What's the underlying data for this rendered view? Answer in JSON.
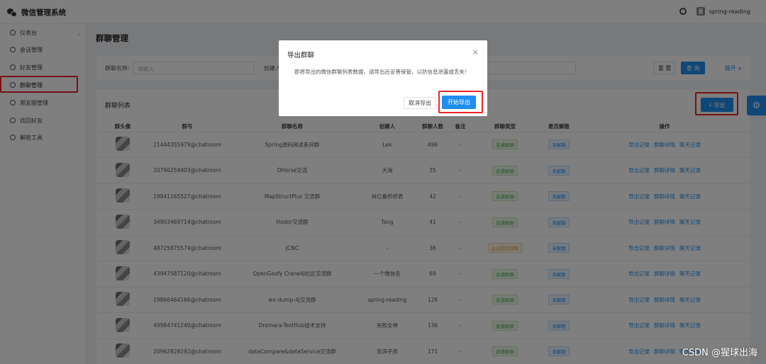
{
  "app": {
    "title": "微信管理系统",
    "user": "spring-reading"
  },
  "sidebar": {
    "items": [
      {
        "label": "仪表台",
        "icon": "dashboard-icon"
      },
      {
        "label": "会话管理",
        "icon": "chat-icon"
      },
      {
        "label": "好友管理",
        "icon": "contacts-icon"
      },
      {
        "label": "群聊管理",
        "icon": "group-chat-icon"
      },
      {
        "label": "朋友圈管理",
        "icon": "moments-icon"
      },
      {
        "label": "找回好友",
        "icon": "recover-icon"
      },
      {
        "label": "解密工具",
        "icon": "key-icon"
      }
    ]
  },
  "page": {
    "title": "群聊管理"
  },
  "search": {
    "group_name_label": "群聊名称:",
    "group_name_placeholder": "请输入",
    "creator_label": "创建人",
    "reset_label": "重 置",
    "search_label": "查 询",
    "expand_label": "展开"
  },
  "list": {
    "title": "群聊列表",
    "export_label": "导出",
    "columns": [
      "群头像",
      "群号",
      "群聊名称",
      "创建人",
      "群聊人数",
      "备注",
      "群聊类型",
      "是否解散",
      "操作"
    ],
    "rows": [
      {
        "id": "21444355979@chatroom",
        "name": "Spring源码阅读系列群",
        "creator": "Lex",
        "count": "496",
        "note": "-",
        "type": "普通群聊",
        "type_color": "green",
        "status": "未解散"
      },
      {
        "id": "20790259403@chatroom",
        "name": "DHorse交流",
        "creator": "大海",
        "count": "35",
        "note": "-",
        "type": "普通群聊",
        "type_color": "green",
        "status": "未解散"
      },
      {
        "id": "19841265527@chatroom",
        "name": "MapStructPlus 交流群",
        "creator": "肖红番桥桥表",
        "count": "42",
        "note": "-",
        "type": "普通群聊",
        "type_color": "green",
        "status": "未解散"
      },
      {
        "id": "34903469714@chatroom",
        "name": "Hodor交流群",
        "creator": "Tang",
        "count": "41",
        "note": "-",
        "type": "普通群聊",
        "type_color": "green",
        "status": "未解散"
      },
      {
        "id": "48725875574@chatroom",
        "name": "JCNC",
        "creator": "-",
        "count": "36",
        "note": "-",
        "type": "企业微信群聊",
        "type_color": "orange",
        "status": "未解散"
      },
      {
        "id": "43947587120@chatroom",
        "name": "OpenGoofy Crane4j社区交流群",
        "creator": "一个微信名",
        "count": "69",
        "note": "-",
        "type": "普通群聊",
        "type_color": "green",
        "status": "未解散"
      },
      {
        "id": "19866464166@chatroom",
        "name": "wx-dump-4j交流群",
        "creator": "spring-reading",
        "count": "126",
        "note": "-",
        "type": "普通群聊",
        "type_color": "green",
        "status": "未解散"
      },
      {
        "id": "49984741240@chatroom",
        "name": "Dromara-TestHub技术支持",
        "creator": "失败女神",
        "count": "136",
        "note": "-",
        "type": "普通群聊",
        "type_color": "green",
        "status": "未解散"
      },
      {
        "id": "20962829292@chatroom",
        "name": "dataCompare&dataService交流群",
        "creator": "澎湃子房",
        "count": "171",
        "note": "-",
        "type": "普通群聊",
        "type_color": "green",
        "status": "未解散"
      }
    ],
    "actions": [
      "导出记录",
      "群聊详情",
      "聊天记录"
    ]
  },
  "dialog": {
    "title": "导出群聊",
    "message": "即将导出的微信群聊列表数据，请导出后妥善保管，以防信息泄露或丢失！",
    "cancel_label": "取消导出",
    "confirm_label": "开始导出",
    "close_symbol": "×"
  },
  "watermark": "CSDN @猩球出海",
  "colors": {
    "primary": "#1f8ef1",
    "highlight": "#e8272a"
  }
}
